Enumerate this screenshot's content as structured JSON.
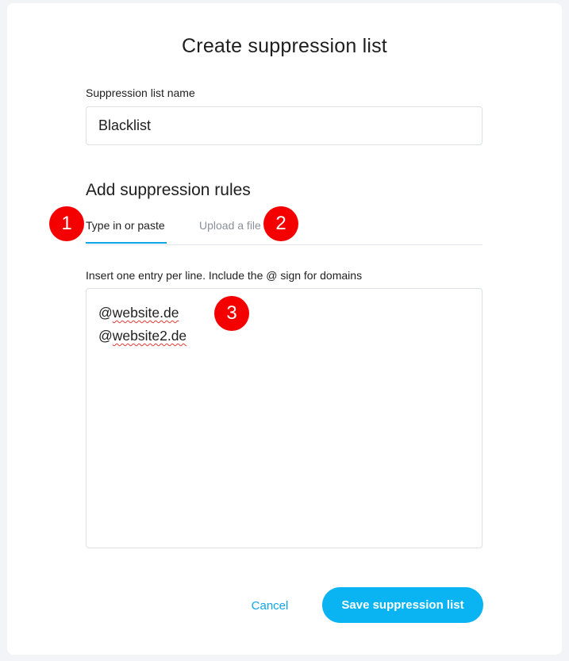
{
  "dialog": {
    "title": "Create suppression list"
  },
  "name_field": {
    "label": "Suppression list name",
    "value": "Blacklist"
  },
  "rules_section": {
    "heading": "Add suppression rules",
    "tabs": [
      {
        "label": "Type in or paste",
        "active": true
      },
      {
        "label": "Upload a file",
        "active": false
      }
    ],
    "hint": "Insert one entry per line. Include the @ sign for domains",
    "entries": [
      {
        "prefix": "@",
        "domain": "website.de"
      },
      {
        "prefix": "@",
        "domain": "website2.de"
      }
    ]
  },
  "actions": {
    "cancel_label": "Cancel",
    "save_label": "Save suppression list"
  },
  "annotations": [
    "1",
    "2",
    "3"
  ],
  "colors": {
    "accent": "#0ab4f3",
    "marker": "#f50000",
    "background": "#f3f4f8"
  }
}
